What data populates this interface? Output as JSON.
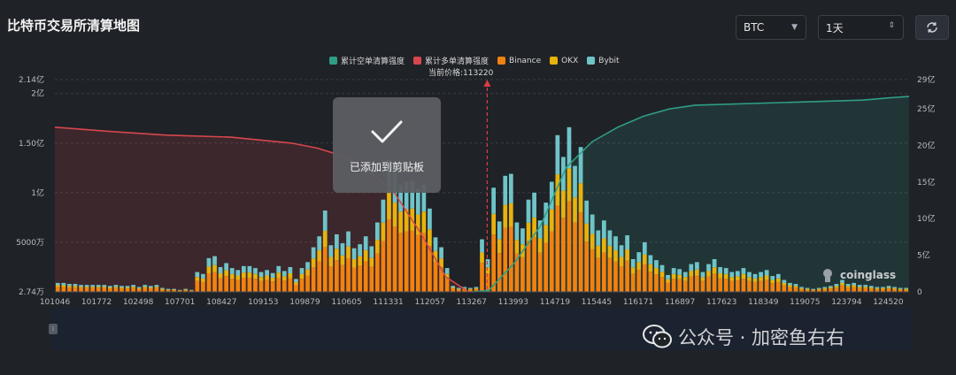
{
  "header": {
    "title": "比特币交易所清算地图",
    "coin_select": "BTC",
    "period_select": "1天"
  },
  "toast": {
    "message": "已添加到剪贴板"
  },
  "logo": {
    "text": "coinglass"
  },
  "watermark": {
    "text": "公众号 · 加密鱼右右"
  },
  "colors": {
    "short_cum": "#2f9e86",
    "long_cum": "#d6474d",
    "binance": "#f0820f",
    "okx": "#e8b20d",
    "bybit": "#6fc4c8"
  },
  "chart_data": {
    "type": "bar",
    "title": "",
    "current_price_label": "当前价格:113220",
    "current_price": 113220,
    "legend": [
      "累计空单清算强度",
      "累计多单清算强度",
      "Binance",
      "OKX",
      "Bybit"
    ],
    "x_tick_labels": [
      "101046",
      "101772",
      "102498",
      "107701",
      "108427",
      "109153",
      "109879",
      "110605",
      "111331",
      "112057",
      "113267",
      "113993",
      "114719",
      "115445",
      "116171",
      "116897",
      "117623",
      "118349",
      "119075",
      "123794",
      "124520"
    ],
    "y_left_tick_labels": [
      "2.74万",
      "5000万",
      "1亿",
      "1.50亿",
      "2亿",
      "2.14亿"
    ],
    "y_right_tick_labels": [
      "0",
      "5亿",
      "10亿",
      "15亿",
      "20亿",
      "25亿",
      "29亿"
    ],
    "y_left_range": [
      0,
      214000000
    ],
    "y_right_range": [
      0,
      2900000000
    ],
    "bars_stack_order": [
      "Binance",
      "OKX",
      "Bybit"
    ],
    "bar_totals_yi": [
      0.09,
      0.09,
      0.08,
      0.08,
      0.07,
      0.07,
      0.07,
      0.07,
      0.07,
      0.06,
      0.07,
      0.06,
      0.06,
      0.07,
      0.05,
      0.07,
      0.06,
      0.07,
      0.04,
      0.03,
      0.03,
      0.02,
      0.03,
      0.02,
      0.2,
      0.18,
      0.34,
      0.36,
      0.25,
      0.29,
      0.24,
      0.22,
      0.26,
      0.26,
      0.24,
      0.2,
      0.22,
      0.19,
      0.26,
      0.21,
      0.25,
      0.13,
      0.24,
      0.3,
      0.45,
      0.56,
      0.82,
      0.47,
      0.58,
      0.49,
      0.61,
      0.44,
      0.48,
      0.56,
      0.46,
      0.7,
      0.93,
      1.33,
      1.2,
      1.08,
      1.11,
      1.12,
      1.04,
      1.08,
      0.84,
      0.55,
      0.45,
      0.24,
      0.06,
      0.04,
      0.05,
      0.04,
      0.05,
      0.53,
      0.33,
      1.05,
      0.71,
      1.17,
      1.19,
      0.7,
      0.64,
      0.93,
      1.0,
      0.72,
      0.9,
      1.11,
      1.58,
      1.36,
      1.66,
      1.27,
      1.46,
      0.92,
      0.78,
      0.62,
      0.72,
      0.62,
      0.56,
      0.47,
      0.57,
      0.33,
      0.4,
      0.5,
      0.37,
      0.32,
      0.27,
      0.17,
      0.24,
      0.23,
      0.2,
      0.28,
      0.3,
      0.2,
      0.28,
      0.33,
      0.25,
      0.24,
      0.2,
      0.21,
      0.24,
      0.2,
      0.18,
      0.2,
      0.22,
      0.16,
      0.18,
      0.12,
      0.09,
      0.08,
      0.05,
      0.04,
      0.03,
      0.04,
      0.05,
      0.06,
      0.08,
      0.12,
      0.08,
      0.09,
      0.07,
      0.07,
      0.06,
      0.05,
      0.05,
      0.06,
      0.05,
      0.04,
      0.04
    ],
    "bar_split_binance_okx_bybit": [
      0.55,
      0.2,
      0.25
    ],
    "long_cumulative_yi": [
      [
        101046,
        1.66
      ],
      [
        102498,
        1.62
      ],
      [
        104200,
        1.58
      ],
      [
        106000,
        1.56
      ],
      [
        107701,
        1.5
      ],
      [
        108427,
        1.45
      ],
      [
        109153,
        1.37
      ],
      [
        109879,
        1.22
      ],
      [
        110605,
        1.0
      ],
      [
        111331,
        0.6
      ],
      [
        112057,
        0.15
      ],
      [
        112700,
        0.0
      ]
    ],
    "short_cumulative_yi": [
      [
        112800,
        0.0
      ],
      [
        113267,
        0.2
      ],
      [
        113993,
        4.0
      ],
      [
        114719,
        9.0
      ],
      [
        115445,
        17.0
      ],
      [
        116171,
        20.5
      ],
      [
        116897,
        22.5
      ],
      [
        117623,
        24.0
      ],
      [
        118349,
        25.0
      ],
      [
        119075,
        25.5
      ],
      [
        123794,
        26.2
      ],
      [
        124520,
        26.5
      ],
      [
        125100,
        26.7
      ]
    ]
  }
}
